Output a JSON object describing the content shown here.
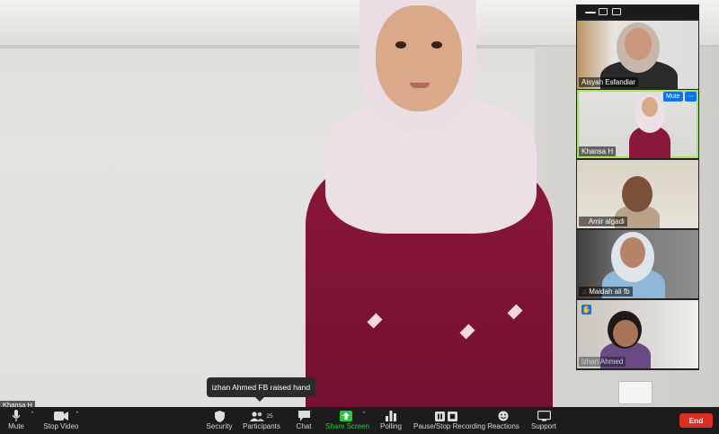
{
  "main": {
    "speaker_label": "Khansa H",
    "toast": "izhan  Ahmed FB raised hand"
  },
  "participants": [
    {
      "name": "Aisyah Esfandiar",
      "muted": false
    },
    {
      "name": "Khansa H",
      "muted": false,
      "active": true,
      "mute_label": "Mute",
      "more_label": "···"
    },
    {
      "name": "Amir algadi",
      "muted": true
    },
    {
      "name": "Maidah   ali  fb",
      "muted": true
    },
    {
      "name": "izhan   Ahmed",
      "muted": false,
      "hand_raised": true
    }
  ],
  "toolbar": {
    "mute": "Mute",
    "stop_video": "Stop Video",
    "security": "Security",
    "participants": "Participants",
    "participants_count": "25",
    "chat": "Chat",
    "share_screen": "Share Screen",
    "polling": "Polling",
    "recording": "Pause/Stop Recording",
    "reactions": "Reactions",
    "support": "Support",
    "end": "End"
  },
  "colors": {
    "accent_blue": "#0e72ed",
    "active_speaker": "#a6e25a",
    "share_green": "#28c840",
    "end_red": "#d93025"
  }
}
